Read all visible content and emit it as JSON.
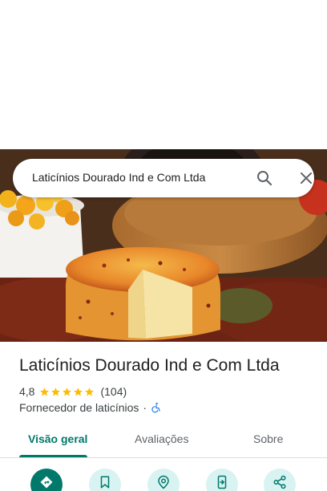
{
  "search": {
    "query": "Laticínios Dourado Ind e Com Ltda"
  },
  "place": {
    "name": "Laticínios Dourado Ind e Com Ltda",
    "rating": "4,8",
    "stars": 5,
    "review_count": "(104)",
    "category": "Fornecedor de laticínios",
    "separator": "·"
  },
  "tabs": [
    {
      "label": "Visão geral",
      "active": true
    },
    {
      "label": "Avaliações",
      "active": false
    },
    {
      "label": "Sobre",
      "active": false
    }
  ],
  "actions": [
    {
      "icon": "directions-icon"
    },
    {
      "icon": "bookmark-icon"
    },
    {
      "icon": "nearby-icon"
    },
    {
      "icon": "send-to-phone-icon"
    },
    {
      "icon": "share-icon"
    }
  ],
  "colors": {
    "accent": "#00796b",
    "star": "#fbbc04",
    "action_bg": "#d8f3f1",
    "accessibility": "#1a73e8"
  }
}
